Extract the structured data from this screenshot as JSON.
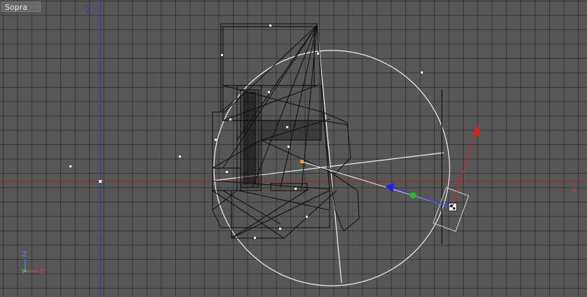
{
  "viewport": {
    "view_name": "Sopra",
    "axis_labels": {
      "vertical": "Z",
      "horizontal": "X"
    },
    "orientation_gizmo": {
      "z": "Z",
      "y": "Y",
      "x": "X"
    }
  },
  "colors": {
    "background": "#575757",
    "grid": "#3a3a3a",
    "x_axis": "#b02020",
    "z_axis": "#2a2ad0",
    "wireframe": "#111111",
    "light_cone": "#ffffff",
    "arrow_red": "#e02020",
    "arrow_blue": "#1a1aff",
    "arrow_green": "#20c020",
    "target": "#ff9900"
  },
  "icons": [
    "camera-icon",
    "target-point-icon",
    "orientation-gizmo-icon"
  ]
}
